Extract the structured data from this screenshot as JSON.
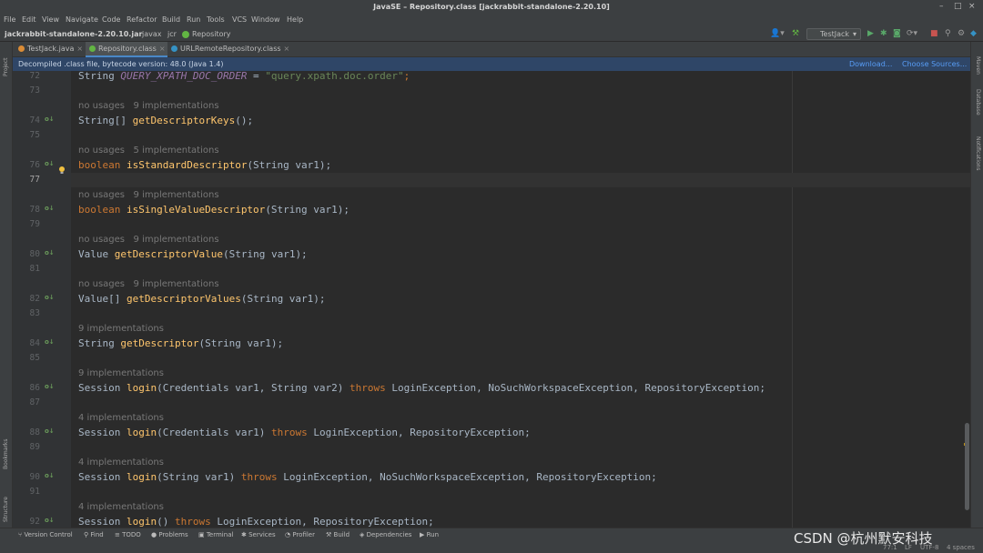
{
  "window": {
    "title": "JavaSE – Repository.class [jackrabbit-standalone-2.20.10]",
    "controls": [
      "–",
      "□",
      "×"
    ]
  },
  "menu": [
    "File",
    "Edit",
    "View",
    "Navigate",
    "Code",
    "Refactor",
    "Build",
    "Run",
    "Tools",
    "VCS",
    "Window",
    "Help"
  ],
  "breadcrumb": [
    "jackrabbit-standalone-2.20.10.jar",
    "javax",
    "jcr",
    "Repository"
  ],
  "toolbar": {
    "run_config": "TestJack"
  },
  "tabs": [
    {
      "label": "TestJack.java",
      "active": false,
      "icon_color": "#db8c36"
    },
    {
      "label": "Repository.class",
      "active": true,
      "icon_color": "#62b543"
    },
    {
      "label": "URLRemoteRepository.class",
      "active": false,
      "icon_color": "#3592c4"
    }
  ],
  "infobar": {
    "message": "Decompiled .class file, bytecode version: 48.0 (Java 1.4)",
    "download": "Download...",
    "choose_sources": "Choose Sources..."
  },
  "left_tool_windows": [
    "Project",
    "Bookmarks",
    "Structure"
  ],
  "right_tool_windows": [
    "Maven",
    "Database",
    "Notifications"
  ],
  "code_lines": [
    {
      "ln": "72"
    },
    {
      "ln": "73"
    },
    {
      "hint": "no usages   9 implementations"
    },
    {
      "ln": "74",
      "impl": true
    },
    {
      "ln": "75"
    },
    {
      "hint": "no usages   5 implementations"
    },
    {
      "ln": "76",
      "impl": true,
      "bulb": true
    },
    {
      "ln": "77",
      "current": true
    },
    {
      "hint": "no usages   9 implementations"
    },
    {
      "ln": "78",
      "impl": true
    },
    {
      "ln": "79"
    },
    {
      "hint": "no usages   9 implementations"
    },
    {
      "ln": "80",
      "impl": true
    },
    {
      "ln": "81"
    },
    {
      "hint": "no usages   9 implementations"
    },
    {
      "ln": "82",
      "impl": true
    },
    {
      "ln": "83"
    },
    {
      "hint": "9 implementations"
    },
    {
      "ln": "84",
      "impl": true
    },
    {
      "ln": "85"
    },
    {
      "hint": "9 implementations"
    },
    {
      "ln": "86",
      "impl": true
    },
    {
      "ln": "87"
    },
    {
      "hint": "4 implementations"
    },
    {
      "ln": "88",
      "impl": true
    },
    {
      "ln": "89"
    },
    {
      "hint": "4 implementations"
    },
    {
      "ln": "90",
      "impl": true
    },
    {
      "ln": "91"
    },
    {
      "hint": "4 implementations"
    },
    {
      "ln": "92",
      "impl": true
    }
  ],
  "code": {
    "l72": {
      "a": "String ",
      "b": "QUERY_XPATH_DOC_ORDER",
      "c": " = ",
      "d": "\"query.xpath.doc.order\"",
      "e": ";"
    },
    "l74": {
      "a": "String[] ",
      "b": "getDescriptorKeys",
      "c": "();"
    },
    "l76": {
      "a": "boolean ",
      "b": "isStandardDescriptor",
      "c": "(String var1);"
    },
    "l78": {
      "a": "boolean ",
      "b": "isSingleValueDescriptor",
      "c": "(String var1);"
    },
    "l80": {
      "a": "Value ",
      "b": "getDescriptorValue",
      "c": "(String var1);"
    },
    "l82": {
      "a": "Value[] ",
      "b": "getDescriptorValues",
      "c": "(String var1);"
    },
    "l84": {
      "a": "String ",
      "b": "getDescriptor",
      "c": "(String var1);"
    },
    "l86": {
      "a": "Session ",
      "b": "login",
      "c": "(Credentials var1, String var2) ",
      "d": "throws",
      "e": " LoginException, NoSuchWorkspaceException, RepositoryException;"
    },
    "l88": {
      "a": "Session ",
      "b": "login",
      "c": "(Credentials var1) ",
      "d": "throws",
      "e": " LoginException, RepositoryException;"
    },
    "l90": {
      "a": "Session ",
      "b": "login",
      "c": "(String var1) ",
      "d": "throws",
      "e": " LoginException, NoSuchWorkspaceException, RepositoryException;"
    },
    "l92": {
      "a": "Session ",
      "b": "login",
      "c": "() ",
      "d": "throws",
      "e": " LoginException, RepositoryException;"
    }
  },
  "status_tools": [
    "Version Control",
    "Find",
    "TODO",
    "Problems",
    "Terminal",
    "Services",
    "Profiler",
    "Build",
    "Dependencies",
    "Run"
  ],
  "status_right": {
    "position": "77:1",
    "line_sep": "LF",
    "encoding": "UTF-8",
    "indent": "4 spaces"
  },
  "watermark": "CSDN @杭州默安科技"
}
